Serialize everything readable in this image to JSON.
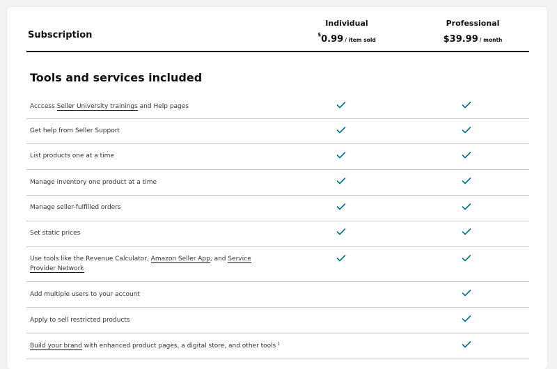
{
  "header": {
    "title": "Subscription",
    "individual": {
      "name": "Individual",
      "currency_symbol": "$",
      "amount": "0.99",
      "period": "/ item sold"
    },
    "professional": {
      "name": "Professional",
      "amount": "$39.99",
      "period": "/ month"
    }
  },
  "section_title": "Tools and services included",
  "colors": {
    "check": "#007185",
    "text": "#0f1111",
    "divider": "#c9cccc"
  },
  "icons": {
    "check": "checkmark-icon"
  },
  "rows": [
    {
      "pre": "Acccess ",
      "link": "Seller University trainings",
      "post": " and Help pages",
      "individual": true,
      "professional": true
    },
    {
      "text": "Get help from Seller Support",
      "individual": true,
      "professional": true
    },
    {
      "text": "List products one at a time",
      "individual": true,
      "professional": true
    },
    {
      "text": "Manage inventory one product at a time",
      "individual": true,
      "professional": true
    },
    {
      "text": "Manage seller-fulfilled orders",
      "individual": true,
      "professional": true
    },
    {
      "text": "Set static prices",
      "individual": true,
      "professional": true
    },
    {
      "pre": "Use tools like the Revenue Calculator, ",
      "link": "Amazon Seller App",
      "mid": ", and ",
      "link2": "Service Provider Network",
      "individual": true,
      "professional": true
    },
    {
      "text": "Add multiple users to your account",
      "individual": false,
      "professional": true
    },
    {
      "text": "Apply to sell restricted products",
      "individual": false,
      "professional": true
    },
    {
      "link": "Build your brand",
      "post": " with enhanced product pages, a digital store, and other tools",
      "footnote": "1",
      "individual": false,
      "professional": true
    }
  ]
}
